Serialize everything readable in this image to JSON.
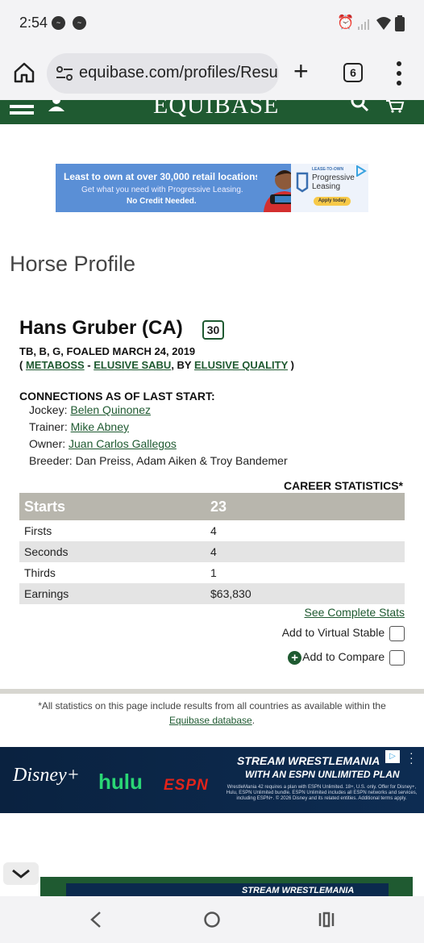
{
  "status_bar": {
    "time": "2:54",
    "icons": [
      "messenger-icon",
      "messenger-icon",
      "alarm-icon",
      "signal-icon",
      "wifi-icon",
      "battery-icon"
    ]
  },
  "browser": {
    "url": "equibase.com/profiles/Resu",
    "tab_count": "6",
    "new_tab_label": "+"
  },
  "site": {
    "logo": "EQUIBASE"
  },
  "ad_top": {
    "line1": "Least to own at over 30,000 retail locations.",
    "line2": "Get what you need with Progressive Leasing.",
    "line3": "No Credit Needed.",
    "brand_small": "LEASE-TO-OWN",
    "brand_name": "Progressive Leasing",
    "cta": "Apply today"
  },
  "page": {
    "title": "Horse Profile"
  },
  "horse": {
    "name": "Hans Gruber (CA)",
    "badge": "30",
    "description": "TB, B, G, FOALED MARCH 24, 2019",
    "pedigree": {
      "open": "( ",
      "sire": "METABOSS",
      "sep": " - ",
      "dam": "ELUSIVE SABU",
      "by": ", BY ",
      "damsire": "ELUSIVE QUALITY",
      "close": " )"
    }
  },
  "connections": {
    "heading": "CONNECTIONS AS OF LAST START:",
    "jockey_label": "Jockey: ",
    "jockey": "Belen Quinonez",
    "trainer_label": "Trainer: ",
    "trainer": "Mike Abney",
    "owner_label": "Owner: ",
    "owner": "Juan Carlos Gallegos",
    "breeder_label": "Breeder: ",
    "breeder": "Dan Preiss, Adam Aiken & Troy Bandemer"
  },
  "career": {
    "heading": "CAREER STATISTICS*",
    "starts_label": "Starts",
    "starts": "23",
    "firsts_label": "Firsts",
    "firsts": "4",
    "seconds_label": "Seconds",
    "seconds": "4",
    "thirds_label": "Thirds",
    "thirds": "1",
    "earnings_label": "Earnings",
    "earnings": "$63,830",
    "see_complete": "See Complete Stats",
    "virtual_stable": "Add to Virtual Stable",
    "compare": "Add to Compare"
  },
  "footnote": {
    "text": "*All statistics on this page include results from all countries as available within the",
    "link": "Equibase database",
    "end": "."
  },
  "ad_bottom": {
    "brand1": "Disney+",
    "brand2": "hulu",
    "brand3": "ESPN",
    "headline1": "STREAM WRESTLEMANIA",
    "headline2": "WITH AN ESPN UNLIMITED PLAN",
    "fine": "WrestleMania 42 requires a plan with ESPN Unlimited. 18+, U.S. only. Offer for Disney+, Hulu, ESPN Unlimited bundle. ESPN Unlimited includes all ESPN networks and services, including ESPN+. © 2026 Disney and its related entities. Additional terms apply.",
    "headline_sticky": "STREAM WRESTLEMANIA"
  },
  "colors": {
    "brand_green": "#1f5a31",
    "stats_header": "#b8b6ad",
    "row_alt": "#e4e4e4"
  }
}
